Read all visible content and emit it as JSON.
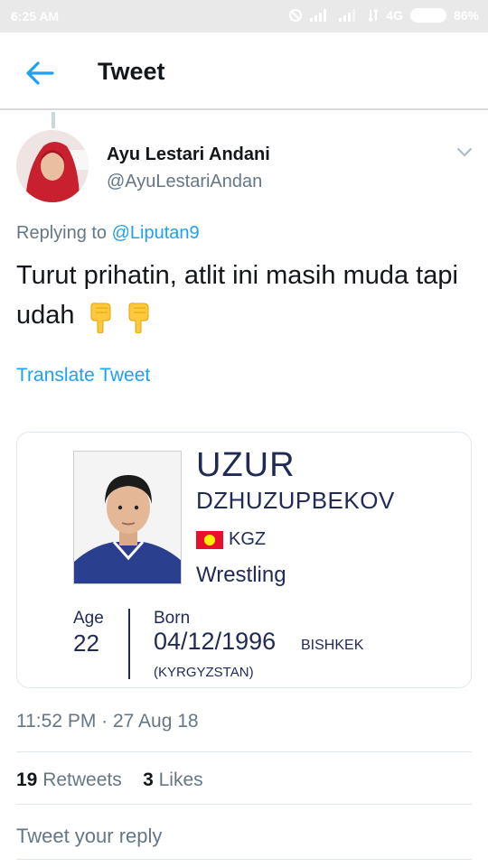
{
  "status_bar": {
    "time": "6:25 AM",
    "network": "4G",
    "battery": "86%",
    "icons": [
      "mute-icon",
      "signal-icon",
      "signal-icon",
      "data-arrows-icon",
      "battery-icon"
    ]
  },
  "app_bar": {
    "title": "Tweet",
    "back_icon": "arrow-left-icon",
    "accent_color": "#1da1f2"
  },
  "tweet": {
    "author_name": "Ayu Lestari Andani",
    "author_handle": "@AyuLestariAndan",
    "replying_prefix": "Replying to",
    "replying_to": "@Liputan9",
    "text": "Turut prihatin, atlit ini masih muda tapi udah",
    "emojis": [
      "backhand-index-pointing-down",
      "backhand-index-pointing-down"
    ],
    "translate_label": "Translate Tweet",
    "timestamp": "11:52 PM · 27 Aug 18",
    "retweets_count": "19",
    "retweets_label": "Retweets",
    "likes_count": "3",
    "likes_label": "Likes"
  },
  "athlete_card": {
    "first_name": "UZUR",
    "last_name": "DZHUZUPBEKOV",
    "country_code": "KGZ",
    "sport": "Wrestling",
    "age_label": "Age",
    "age": "22",
    "born_label": "Born",
    "born_date": "04/12/1996",
    "born_city": "BISHKEK",
    "born_country": "(KYRGYZSTAN)"
  },
  "reply": {
    "placeholder": "Tweet your reply"
  }
}
